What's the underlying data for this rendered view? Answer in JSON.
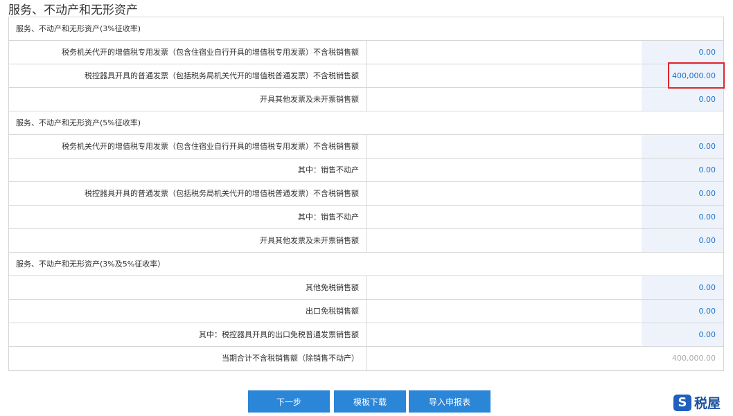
{
  "page_title": "服务、不动产和无形资产",
  "sections": [
    {
      "header": "服务、不动产和无形资产(3%征收率)",
      "rows": [
        {
          "label": "税务机关代开的增值税专用发票（包含住宿业自行开具的增值税专用发票）不含税销售额",
          "value": "0.00"
        },
        {
          "label": "税控器具开具的普通发票（包括税务局机关代开的增值税普通发票）不含税销售额",
          "value": "400,000.00"
        },
        {
          "label": "开具其他发票及未开票销售额",
          "value": "0.00"
        }
      ]
    },
    {
      "header": "服务、不动产和无形资产(5%征收率)",
      "rows": [
        {
          "label": "税务机关代开的增值税专用发票（包含住宿业自行开具的增值税专用发票）不含税销售额",
          "value": "0.00"
        },
        {
          "label": "其中：销售不动产",
          "value": "0.00"
        },
        {
          "label": "税控器具开具的普通发票（包括税务局机关代开的增值税普通发票）不含税销售额",
          "value": "0.00"
        },
        {
          "label": "其中：销售不动产",
          "value": "0.00"
        },
        {
          "label": "开具其他发票及未开票销售额",
          "value": "0.00"
        }
      ]
    },
    {
      "header": "服务、不动产和无形资产(3%及5%征收率）",
      "rows": [
        {
          "label": "其他免税销售额",
          "value": "0.00"
        },
        {
          "label": "出口免税销售额",
          "value": "0.00"
        },
        {
          "label": "其中：税控器具开具的出口免税普通发票销售额",
          "value": "0.00"
        },
        {
          "label": "当期合计不含税销售额（除销售不动产）",
          "value": "400,000.00"
        }
      ]
    }
  ],
  "buttons": {
    "next": "下一步",
    "template_download": "模板下载",
    "import_report": "导入申报表"
  },
  "watermark": {
    "mark": "S",
    "text": "税屋"
  },
  "colors": {
    "accent": "#2b86d8",
    "value_text": "#1a6fc9",
    "input_bg": "#eef3fb",
    "highlight": "#e0262e"
  }
}
